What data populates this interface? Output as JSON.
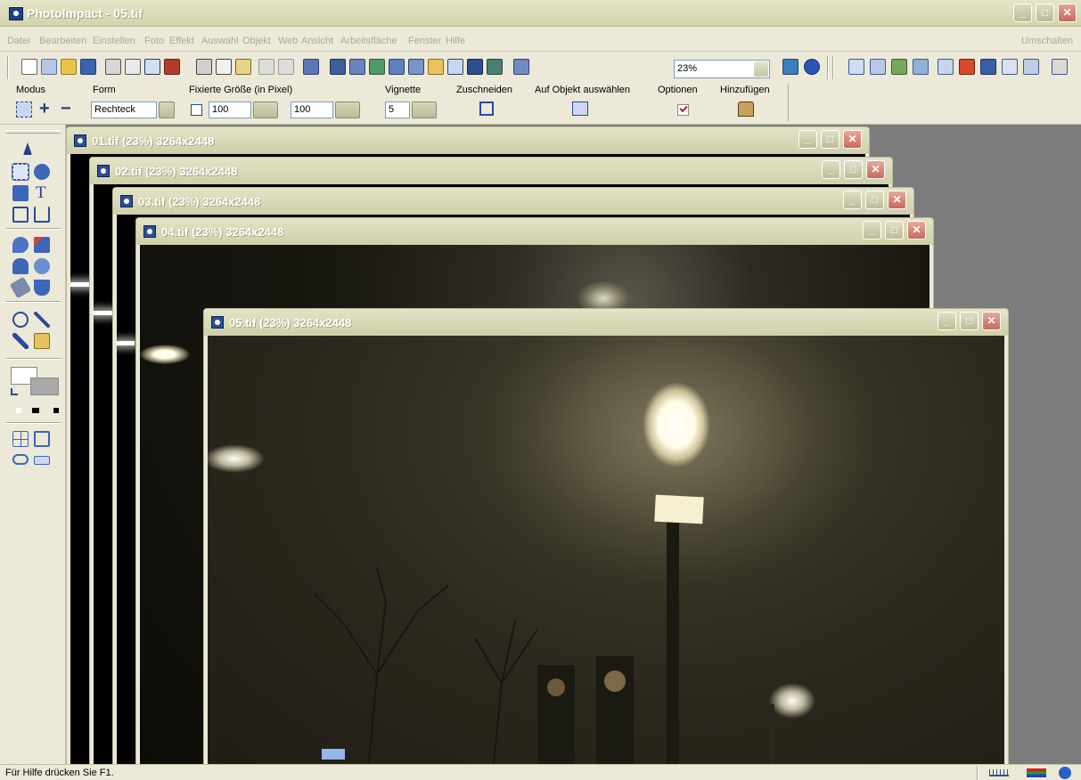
{
  "app": {
    "title": "PhotoImpact - 05.tif"
  },
  "window_controls": {
    "minimize": "_",
    "maximize": "□",
    "close": "✕"
  },
  "menu": {
    "items": [
      "Datei",
      "Bearbeiten",
      "Einstellen",
      "Foto",
      "Effekt",
      "Auswahl",
      "Objekt",
      "Web",
      "Ansicht",
      "Arbeitsfläche",
      "Fenster",
      "Hilfe"
    ],
    "right": "Umschalten"
  },
  "toolbar": {
    "zoom_value": "23%"
  },
  "options": {
    "modus_label": "Modus",
    "modus_plus": "+",
    "modus_minus": "−",
    "form_label": "Form",
    "form_value": "Rechteck",
    "fixed_size_label": "Fixierte Größe (in Pixel)",
    "width_value": "100",
    "height_value": "100",
    "vignette_label": "Vignette",
    "vignette_value": "5",
    "crop_label": "Zuschneiden",
    "select_on_object_label": "Auf Objekt auswählen",
    "options_label": "Optionen",
    "add_label": "Hinzufügen"
  },
  "tools": {
    "text_tool_glyph": "T"
  },
  "documents": [
    {
      "title": "01.tif (23%) 3264x2448"
    },
    {
      "title": "02.tif (23%) 3264x2448"
    },
    {
      "title": "03.tif (23%) 3264x2448"
    },
    {
      "title": "04.tif (23%) 3264x2448"
    },
    {
      "title": "05.tif (23%) 3264x2448"
    }
  ],
  "status": {
    "text": "Für Hilfe drücken Sie F1."
  },
  "colors": {
    "title_bar": "#d3d4ac",
    "workspace": "#7c7c7c",
    "close_button": "#c56a5c",
    "photo_background": "#2c2a1e"
  }
}
